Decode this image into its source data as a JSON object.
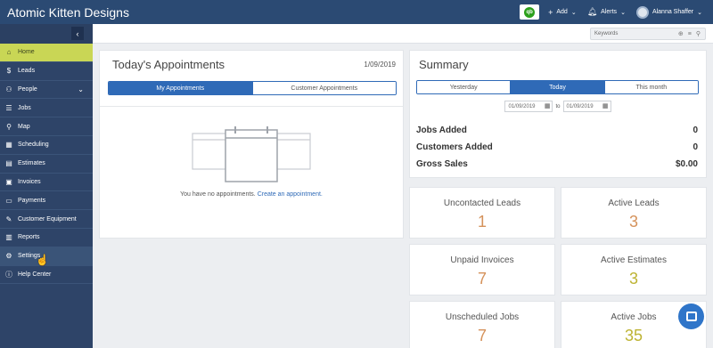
{
  "app": {
    "brand": "Atomic Kitten Designs"
  },
  "topbar": {
    "qb_label": "qb",
    "add_label": "Add",
    "alerts_label": "Alerts",
    "user_name": "Alanna Shaffer"
  },
  "search": {
    "placeholder": "Keywords"
  },
  "sidebar": {
    "items": [
      {
        "label": "Home",
        "icon": "home-icon"
      },
      {
        "label": "Leads",
        "icon": "dollar-icon"
      },
      {
        "label": "People",
        "icon": "people-icon"
      },
      {
        "label": "Jobs",
        "icon": "list-icon"
      },
      {
        "label": "Map",
        "icon": "map-pin-icon"
      },
      {
        "label": "Scheduling",
        "icon": "calendar-icon"
      },
      {
        "label": "Estimates",
        "icon": "calculator-icon"
      },
      {
        "label": "Invoices",
        "icon": "invoice-icon"
      },
      {
        "label": "Payments",
        "icon": "credit-card-icon"
      },
      {
        "label": "Customer Equipment",
        "icon": "wrench-icon"
      },
      {
        "label": "Reports",
        "icon": "bar-chart-icon"
      },
      {
        "label": "Settings",
        "icon": "gear-icon"
      },
      {
        "label": "Help Center",
        "icon": "info-icon"
      }
    ]
  },
  "appointments": {
    "title": "Today's Appointments",
    "date": "1/09/2019",
    "tabs": [
      "My Appointments",
      "Customer Appointments"
    ],
    "empty_text": "You have no appointments.",
    "create_link": "Create an appointment."
  },
  "summary": {
    "title": "Summary",
    "tabs": [
      "Yesterday",
      "Today",
      "This month"
    ],
    "date_from": "01/09/2019",
    "date_to": "01/09/2019",
    "to_label": "to",
    "rows": [
      {
        "label": "Jobs Added",
        "value": "0"
      },
      {
        "label": "Customers Added",
        "value": "0"
      },
      {
        "label": "Gross Sales",
        "value": "$0.00"
      }
    ]
  },
  "stats": [
    {
      "label": "Uncontacted Leads",
      "value": "1"
    },
    {
      "label": "Active Leads",
      "value": "3"
    },
    {
      "label": "Unpaid Invoices",
      "value": "7"
    },
    {
      "label": "Active Estimates",
      "value": "3"
    },
    {
      "label": "Unscheduled Jobs",
      "value": "7"
    },
    {
      "label": "Active Jobs",
      "value": "35"
    }
  ],
  "colors": {
    "topbar": "#2b4a73",
    "sidebar": "#2e4468",
    "active_nav": "#c9d655",
    "primary": "#2f6ab7",
    "stat_orange": "#d5925b",
    "stat_olive": "#bdb332"
  }
}
